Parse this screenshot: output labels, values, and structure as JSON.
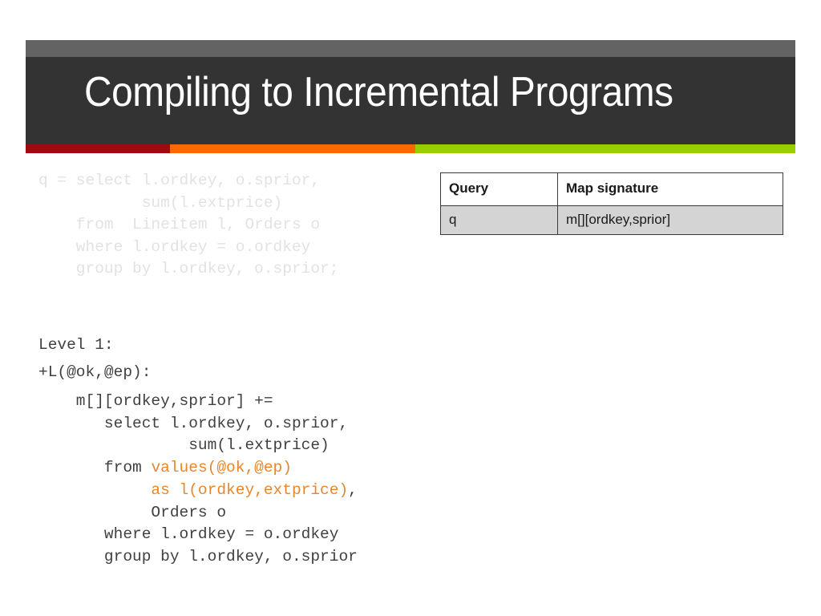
{
  "slide": {
    "title": "Compiling to Incremental Programs",
    "accent_colors": {
      "header_gray": "#636363",
      "header_dark": "#333333",
      "bar_red": "#9E0B0F",
      "bar_orange": "#FA6800",
      "bar_green": "#9ACD00",
      "highlight_orange": "#E8862C",
      "faded_text": "#E2E2E2",
      "code_text": "#404040"
    }
  },
  "faded_query": {
    "lines": [
      "q = select l.ordkey, o.sprior,",
      "           sum(l.extprice)",
      "    from  Lineitem l, Orders o",
      "    where l.ordkey = o.ordkey",
      "    group by l.ordkey, o.sprior;"
    ],
    "text": "q = select l.ordkey, o.sprior,\n           sum(l.extprice)\n    from  Lineitem l, Orders o\n    where l.ordkey = o.ordkey\n    group by l.ordkey, o.sprior;"
  },
  "level_label": {
    "level": "Level 1:",
    "trigger": "+L(@ok,@ep):",
    "text": "Level 1:\n+L(@ok,@ep):"
  },
  "incremental_code": {
    "line1": "    m[][ordkey,sprior] +=",
    "line2": "       select l.ordkey, o.sprior,",
    "line3": "                sum(l.extprice)",
    "line4_prefix": "       from ",
    "line4_highlight": "values(@ok,@ep)",
    "line5_highlight": "            as l(ordkey,extprice)",
    "line5_suffix": ",",
    "line6": "            Orders o",
    "line7": "       where l.ordkey = o.ordkey",
    "line8": "       group by l.ordkey, o.sprior"
  },
  "map_table": {
    "headers": [
      "Query",
      "Map signature"
    ],
    "rows": [
      [
        "q",
        "m[][ordkey,sprior]"
      ]
    ]
  }
}
